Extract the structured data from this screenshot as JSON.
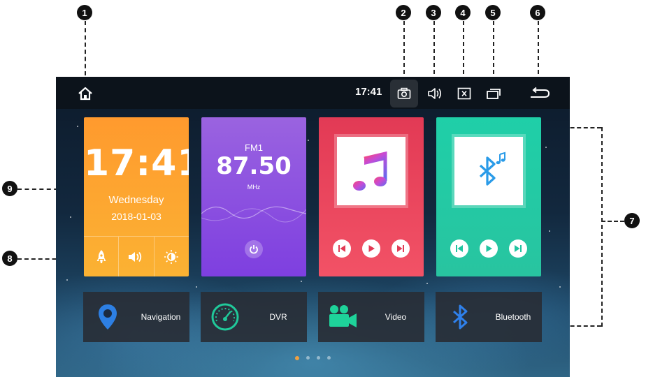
{
  "callouts": [
    "1",
    "2",
    "3",
    "4",
    "5",
    "6",
    "7",
    "8",
    "9"
  ],
  "status_bar": {
    "time": "17:41",
    "icons": [
      "home-icon",
      "camera-icon",
      "volume-icon",
      "close-box-icon",
      "recent-apps-icon",
      "back-icon"
    ]
  },
  "clock_widget": {
    "time": "17:41",
    "day": "Wednesday",
    "date": "2018-01-03",
    "quick_buttons": [
      "rocket-icon",
      "volume-icon",
      "brightness-icon"
    ]
  },
  "radio_widget": {
    "band": "FM1",
    "frequency": "87.50",
    "unit": "MHz"
  },
  "music_widget": {
    "icon": "music-note-icon",
    "controls": [
      "previous-icon",
      "play-icon",
      "next-icon"
    ]
  },
  "bluetooth_widget": {
    "icon": "bluetooth-music-icon",
    "controls": [
      "previous-icon",
      "play-icon",
      "next-icon"
    ]
  },
  "shortcuts": [
    {
      "label": "Navigation",
      "icon": "map-pin-icon"
    },
    {
      "label": "DVR",
      "icon": "speedometer-icon"
    },
    {
      "label": "Video",
      "icon": "video-camera-icon"
    },
    {
      "label": "Bluetooth",
      "icon": "bluetooth-icon"
    }
  ],
  "pagination": {
    "pages": 4,
    "current": 1
  },
  "colors": {
    "clock_tile": "#fba632",
    "radio_tile": "#8a4fe0",
    "music_tile": "#ea4560",
    "bluetooth_tile": "#22c9a4",
    "shortcut_bg": "#282e36"
  }
}
